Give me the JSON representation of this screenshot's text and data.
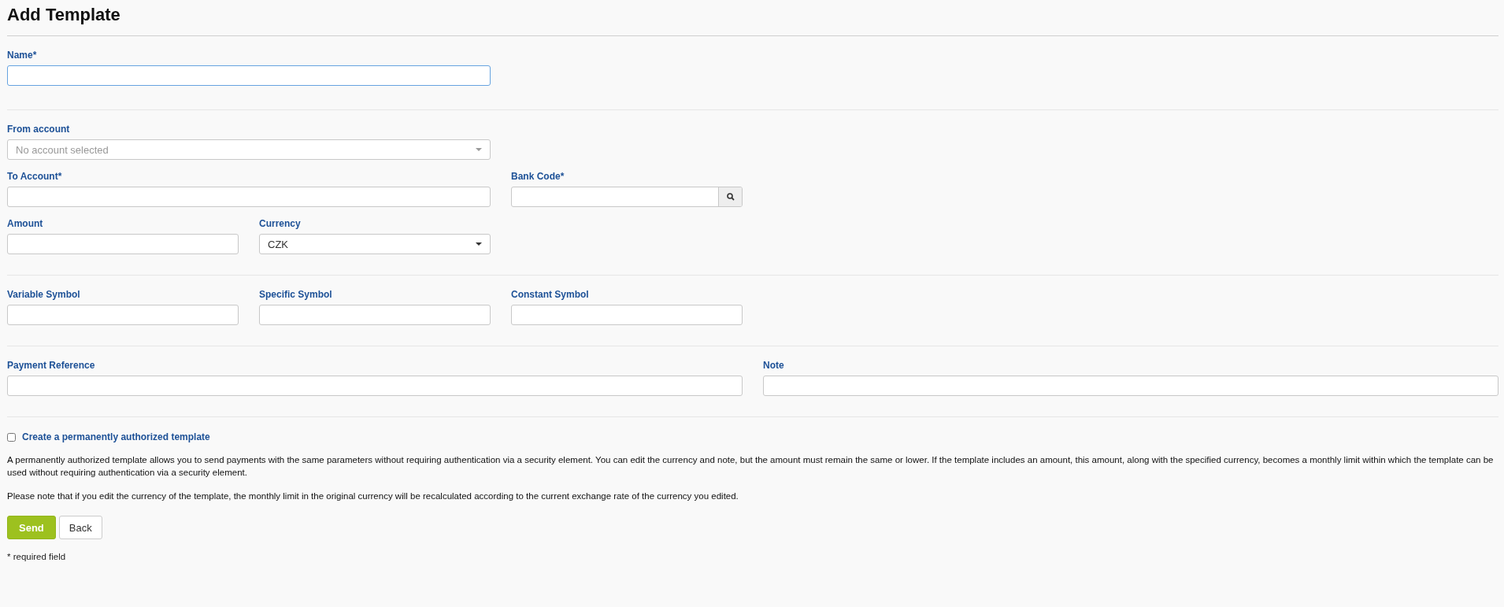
{
  "title": "Add Template",
  "sections": [
    {
      "fields": [
        {
          "label": "Name*",
          "kind": "text",
          "focused": true
        }
      ]
    },
    {
      "fields": [
        {
          "label": "From account",
          "kind": "select",
          "placeholder": "No account selected"
        },
        {
          "label": "To Account*",
          "kind": "text",
          "focused": false
        },
        {
          "label": "Bank Code*",
          "kind": "search",
          "focused": false
        },
        {
          "label": "Amount",
          "kind": "text",
          "focused": false
        },
        {
          "label": "Currency",
          "kind": "select",
          "value": "CZK"
        }
      ]
    },
    {
      "fields": [
        {
          "label": "Variable Symbol",
          "kind": "text",
          "focused": false
        },
        {
          "label": "Specific Symbol",
          "kind": "text",
          "focused": false
        },
        {
          "label": "Constant Symbol",
          "kind": "text",
          "focused": false
        }
      ]
    },
    {
      "fields": [
        {
          "label": "Payment Reference",
          "kind": "text",
          "focused": false
        },
        {
          "label": "Note",
          "kind": "text",
          "focused": false
        }
      ]
    }
  ],
  "permanent": {
    "label": "Create a permanently authorized template",
    "checked": false
  },
  "paragraphs": [
    "A permanently authorized template allows you to send payments with the same parameters without requiring authentication via a security element. You can edit the currency and note, but the amount must remain the same or lower. If the template includes an amount, this amount, along with the specified currency, becomes a monthly limit within which the template can be used without requiring authentication via a security element.",
    "Please note that if you edit the currency of the template, the monthly limit in the original currency will be recalculated according to the current exchange rate of the currency you edited."
  ],
  "buttons": [
    {
      "label": "Send",
      "kind": "primary"
    },
    {
      "label": "Back",
      "kind": "default"
    }
  ],
  "footnote": "* required field"
}
